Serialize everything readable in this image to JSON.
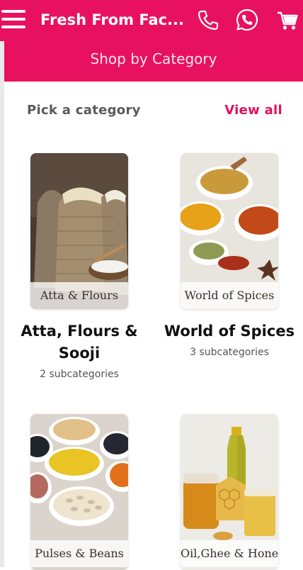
{
  "header": {
    "brand": "Fresh From Fac...",
    "menu_icon": "hamburger-menu-icon",
    "phone_icon": "phone-icon",
    "whatsapp_icon": "whatsapp-icon",
    "cart_icon": "shopping-cart-icon",
    "bg_color": "#e8115f"
  },
  "banner": {
    "title": "Shop by Category"
  },
  "section": {
    "label": "Pick a category",
    "view_all": "View all",
    "accent": "#e0115d"
  },
  "categories": [
    {
      "image_caption": "Atta & Flours",
      "title_line1": "Atta, Flours &",
      "title_line2": "Sooji",
      "subtitle": "2 subcategories"
    },
    {
      "image_caption": "World of Spices",
      "title_line1": "World of Spices",
      "title_line2": "",
      "subtitle": "3 subcategories"
    },
    {
      "image_caption": "Pulses & Beans"
    },
    {
      "image_caption": "Oil,Ghee & Honey"
    }
  ]
}
